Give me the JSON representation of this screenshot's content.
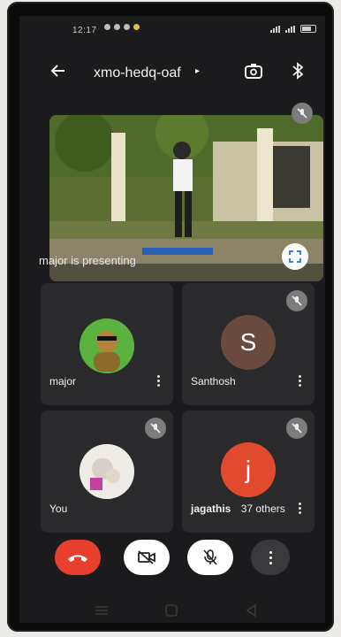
{
  "status_bar": {
    "time": "12:17"
  },
  "header": {
    "meeting_code": "xmo-hedq-oaf",
    "caret": "▸"
  },
  "presentation": {
    "label": "major is presenting"
  },
  "participants": [
    {
      "name": "major",
      "initial": ""
    },
    {
      "name": "Santhosh",
      "initial": "S",
      "color": "#6a4a3c"
    },
    {
      "name": "You",
      "initial": ""
    },
    {
      "name": "jagathis",
      "initial": "j",
      "extra": "37 others",
      "color": "#e14a2f"
    }
  ],
  "colors": {
    "hangup": "#e8402f",
    "control_bg": "#ffffff",
    "more_bg": "#3a3a3c"
  },
  "icons": [
    "back-arrow-icon",
    "switch-camera-icon",
    "bluetooth-icon",
    "fullscreen-icon",
    "mic-off-icon",
    "more-vert-icon",
    "end-call-icon",
    "video-off-icon"
  ]
}
